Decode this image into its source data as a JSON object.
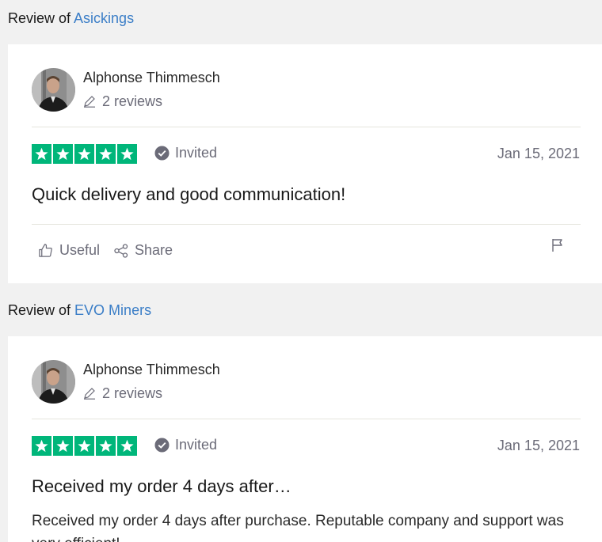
{
  "reviews": [
    {
      "heading_prefix": "Review of",
      "company": "Asickings",
      "consumer": {
        "name": "Alphonse Thimmesch",
        "review_count": "2 reviews"
      },
      "rating": 5,
      "invited_label": "Invited",
      "date": "Jan 15, 2021",
      "title": "Quick delivery and good communication!",
      "text": "",
      "actions": {
        "useful_label": "Useful",
        "share_label": "Share"
      }
    },
    {
      "heading_prefix": "Review of",
      "company": "EVO Miners",
      "consumer": {
        "name": "Alphonse Thimmesch",
        "review_count": "2 reviews"
      },
      "rating": 5,
      "invited_label": "Invited",
      "date": "Jan 15, 2021",
      "title": "Received my order 4 days after…",
      "text": "Received my order 4 days after purchase. Reputable company and support was very efficient!"
    }
  ],
  "colors": {
    "star_green": "#00b67a",
    "link_blue": "#3b7ec7",
    "muted": "#6b6b78"
  },
  "icons": [
    "pencil-icon",
    "invited-check-icon",
    "thumbs-up-icon",
    "share-icon",
    "flag-icon",
    "star-icon"
  ]
}
